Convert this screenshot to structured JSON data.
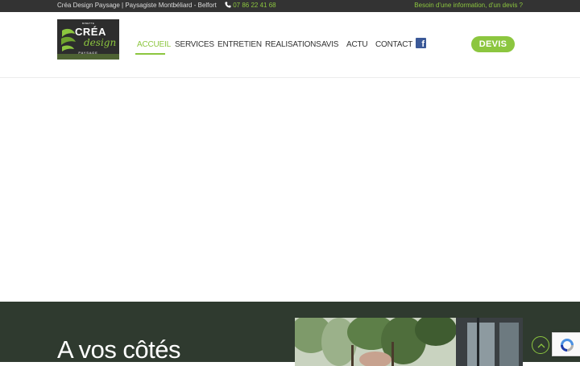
{
  "topbar": {
    "company": "Créa Design Paysage | Paysagiste Montbéliard - Belfort",
    "phone": "07 86 22 41 68",
    "cta": "Besoin d'une information, d'un devis ?"
  },
  "logo": {
    "line1": "MINETTE",
    "line2": "CRÉA",
    "line3": "design",
    "line4": "PAYSAGE"
  },
  "nav": {
    "items": [
      {
        "label": "ACCUEIL",
        "active": true
      },
      {
        "label": "SERVICES",
        "active": false
      },
      {
        "label": "ENTRETIEN",
        "active": false
      },
      {
        "label": "REALISATIONS",
        "active": false
      },
      {
        "label": "AVIS",
        "active": false
      },
      {
        "label": "ACTU",
        "active": false
      },
      {
        "label": "CONTACT",
        "active": false
      }
    ],
    "facebook_icon": "facebook-icon"
  },
  "devis_button": "DEVIS",
  "section": {
    "title": "A vos côtés"
  },
  "colors": {
    "accent": "#8cc63f",
    "topbar": "#333333",
    "dark_section": "#2f3a2f",
    "facebook": "#3b5998"
  },
  "icons": {
    "phone": "phone-icon",
    "scroll_top": "chevron-up-icon",
    "recaptcha": "recaptcha-icon"
  }
}
